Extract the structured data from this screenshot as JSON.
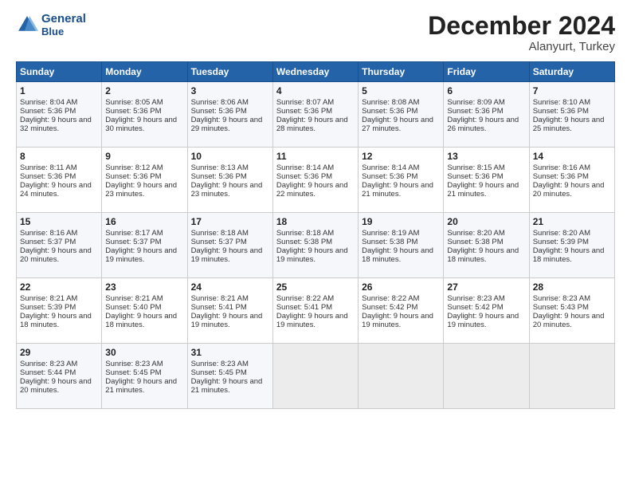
{
  "logo": {
    "text_line1": "General",
    "text_line2": "Blue"
  },
  "header": {
    "month": "December 2024",
    "location": "Alanyurt, Turkey"
  },
  "weekdays": [
    "Sunday",
    "Monday",
    "Tuesday",
    "Wednesday",
    "Thursday",
    "Friday",
    "Saturday"
  ],
  "weeks": [
    [
      {
        "day": "1",
        "sunrise": "8:04 AM",
        "sunset": "5:36 PM",
        "daylight": "9 hours and 32 minutes."
      },
      {
        "day": "2",
        "sunrise": "8:05 AM",
        "sunset": "5:36 PM",
        "daylight": "9 hours and 30 minutes."
      },
      {
        "day": "3",
        "sunrise": "8:06 AM",
        "sunset": "5:36 PM",
        "daylight": "9 hours and 29 minutes."
      },
      {
        "day": "4",
        "sunrise": "8:07 AM",
        "sunset": "5:36 PM",
        "daylight": "9 hours and 28 minutes."
      },
      {
        "day": "5",
        "sunrise": "8:08 AM",
        "sunset": "5:36 PM",
        "daylight": "9 hours and 27 minutes."
      },
      {
        "day": "6",
        "sunrise": "8:09 AM",
        "sunset": "5:36 PM",
        "daylight": "9 hours and 26 minutes."
      },
      {
        "day": "7",
        "sunrise": "8:10 AM",
        "sunset": "5:36 PM",
        "daylight": "9 hours and 25 minutes."
      }
    ],
    [
      {
        "day": "8",
        "sunrise": "8:11 AM",
        "sunset": "5:36 PM",
        "daylight": "9 hours and 24 minutes."
      },
      {
        "day": "9",
        "sunrise": "8:12 AM",
        "sunset": "5:36 PM",
        "daylight": "9 hours and 23 minutes."
      },
      {
        "day": "10",
        "sunrise": "8:13 AM",
        "sunset": "5:36 PM",
        "daylight": "9 hours and 23 minutes."
      },
      {
        "day": "11",
        "sunrise": "8:14 AM",
        "sunset": "5:36 PM",
        "daylight": "9 hours and 22 minutes."
      },
      {
        "day": "12",
        "sunrise": "8:14 AM",
        "sunset": "5:36 PM",
        "daylight": "9 hours and 21 minutes."
      },
      {
        "day": "13",
        "sunrise": "8:15 AM",
        "sunset": "5:36 PM",
        "daylight": "9 hours and 21 minutes."
      },
      {
        "day": "14",
        "sunrise": "8:16 AM",
        "sunset": "5:36 PM",
        "daylight": "9 hours and 20 minutes."
      }
    ],
    [
      {
        "day": "15",
        "sunrise": "8:16 AM",
        "sunset": "5:37 PM",
        "daylight": "9 hours and 20 minutes."
      },
      {
        "day": "16",
        "sunrise": "8:17 AM",
        "sunset": "5:37 PM",
        "daylight": "9 hours and 19 minutes."
      },
      {
        "day": "17",
        "sunrise": "8:18 AM",
        "sunset": "5:37 PM",
        "daylight": "9 hours and 19 minutes."
      },
      {
        "day": "18",
        "sunrise": "8:18 AM",
        "sunset": "5:38 PM",
        "daylight": "9 hours and 19 minutes."
      },
      {
        "day": "19",
        "sunrise": "8:19 AM",
        "sunset": "5:38 PM",
        "daylight": "9 hours and 18 minutes."
      },
      {
        "day": "20",
        "sunrise": "8:20 AM",
        "sunset": "5:38 PM",
        "daylight": "9 hours and 18 minutes."
      },
      {
        "day": "21",
        "sunrise": "8:20 AM",
        "sunset": "5:39 PM",
        "daylight": "9 hours and 18 minutes."
      }
    ],
    [
      {
        "day": "22",
        "sunrise": "8:21 AM",
        "sunset": "5:39 PM",
        "daylight": "9 hours and 18 minutes."
      },
      {
        "day": "23",
        "sunrise": "8:21 AM",
        "sunset": "5:40 PM",
        "daylight": "9 hours and 18 minutes."
      },
      {
        "day": "24",
        "sunrise": "8:21 AM",
        "sunset": "5:41 PM",
        "daylight": "9 hours and 19 minutes."
      },
      {
        "day": "25",
        "sunrise": "8:22 AM",
        "sunset": "5:41 PM",
        "daylight": "9 hours and 19 minutes."
      },
      {
        "day": "26",
        "sunrise": "8:22 AM",
        "sunset": "5:42 PM",
        "daylight": "9 hours and 19 minutes."
      },
      {
        "day": "27",
        "sunrise": "8:23 AM",
        "sunset": "5:42 PM",
        "daylight": "9 hours and 19 minutes."
      },
      {
        "day": "28",
        "sunrise": "8:23 AM",
        "sunset": "5:43 PM",
        "daylight": "9 hours and 20 minutes."
      }
    ],
    [
      {
        "day": "29",
        "sunrise": "8:23 AM",
        "sunset": "5:44 PM",
        "daylight": "9 hours and 20 minutes."
      },
      {
        "day": "30",
        "sunrise": "8:23 AM",
        "sunset": "5:45 PM",
        "daylight": "9 hours and 21 minutes."
      },
      {
        "day": "31",
        "sunrise": "8:23 AM",
        "sunset": "5:45 PM",
        "daylight": "9 hours and 21 minutes."
      },
      null,
      null,
      null,
      null
    ]
  ],
  "labels": {
    "sunrise": "Sunrise:",
    "sunset": "Sunset:",
    "daylight": "Daylight:"
  }
}
